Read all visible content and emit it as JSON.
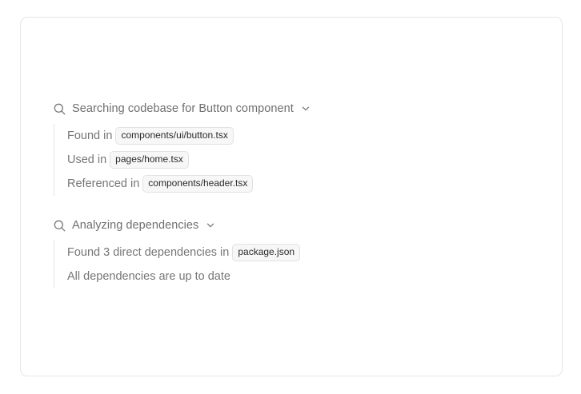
{
  "sections": [
    {
      "title": "Searching codebase for Button component",
      "items": [
        {
          "text": "Found in",
          "badge": "components/ui/button.tsx"
        },
        {
          "text": "Used in",
          "badge": "pages/home.tsx"
        },
        {
          "text": "Referenced in",
          "badge": "components/header.tsx"
        }
      ]
    },
    {
      "title": "Analyzing dependencies",
      "items": [
        {
          "text": "Found 3 direct dependencies in",
          "badge": "package.json"
        },
        {
          "text": "All dependencies are up to date"
        }
      ]
    }
  ],
  "icons": {
    "search": "search-icon",
    "chevron": "chevron-down-icon"
  },
  "colors": {
    "text": "#6f6f6f",
    "badge_text": "#2a2a2a",
    "badge_bg": "#f7f7f7",
    "border": "#e6e6e6"
  }
}
